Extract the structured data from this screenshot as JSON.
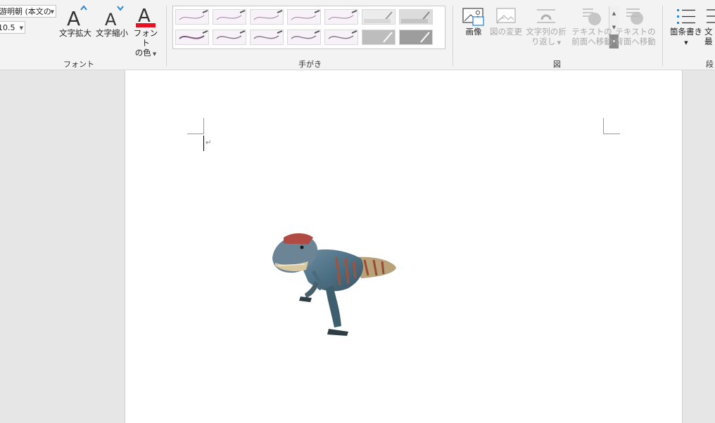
{
  "font_group": {
    "font_name": "游明朝 (本文の",
    "font_size": "10.5",
    "grow_label": "文字拡大",
    "shrink_label": "文字縮小",
    "color_label_line1": "フォント",
    "color_label_line2": "の色",
    "group_label": "フォント",
    "font_color": "#e81123"
  },
  "ink_group": {
    "group_label": "手がき",
    "pens": [
      {
        "style": "thin-pen"
      },
      {
        "style": "thin-pen"
      },
      {
        "style": "thin-pen"
      },
      {
        "style": "thin-pen"
      },
      {
        "style": "thin-pen"
      },
      {
        "style": "highlighter-light"
      },
      {
        "style": "highlighter-light"
      },
      {
        "style": "medium-pen"
      },
      {
        "style": "medium-pen"
      },
      {
        "style": "medium-pen"
      },
      {
        "style": "medium-pen"
      },
      {
        "style": "medium-pen"
      },
      {
        "style": "highlighter-medium"
      },
      {
        "style": "highlighter-dark"
      }
    ]
  },
  "picture_group": {
    "group_label": "図",
    "image_label": "画像",
    "change_label": "図の変更",
    "wrap_label_line1": "文字列の折",
    "wrap_label_line2": "り返し",
    "front_label_line1": "テキストの",
    "front_label_line2": "前面へ移動",
    "back_label_line1": "テキストの",
    "back_label_line2": "背面へ移動"
  },
  "paragraph_group": {
    "bullets_label": "箇条書き",
    "next_label_line1": "文",
    "next_label_line2": "最",
    "group_label_partial": "段"
  },
  "document": {
    "paragraph_mark": "↵",
    "image_subject": "dinosaur-figure"
  }
}
